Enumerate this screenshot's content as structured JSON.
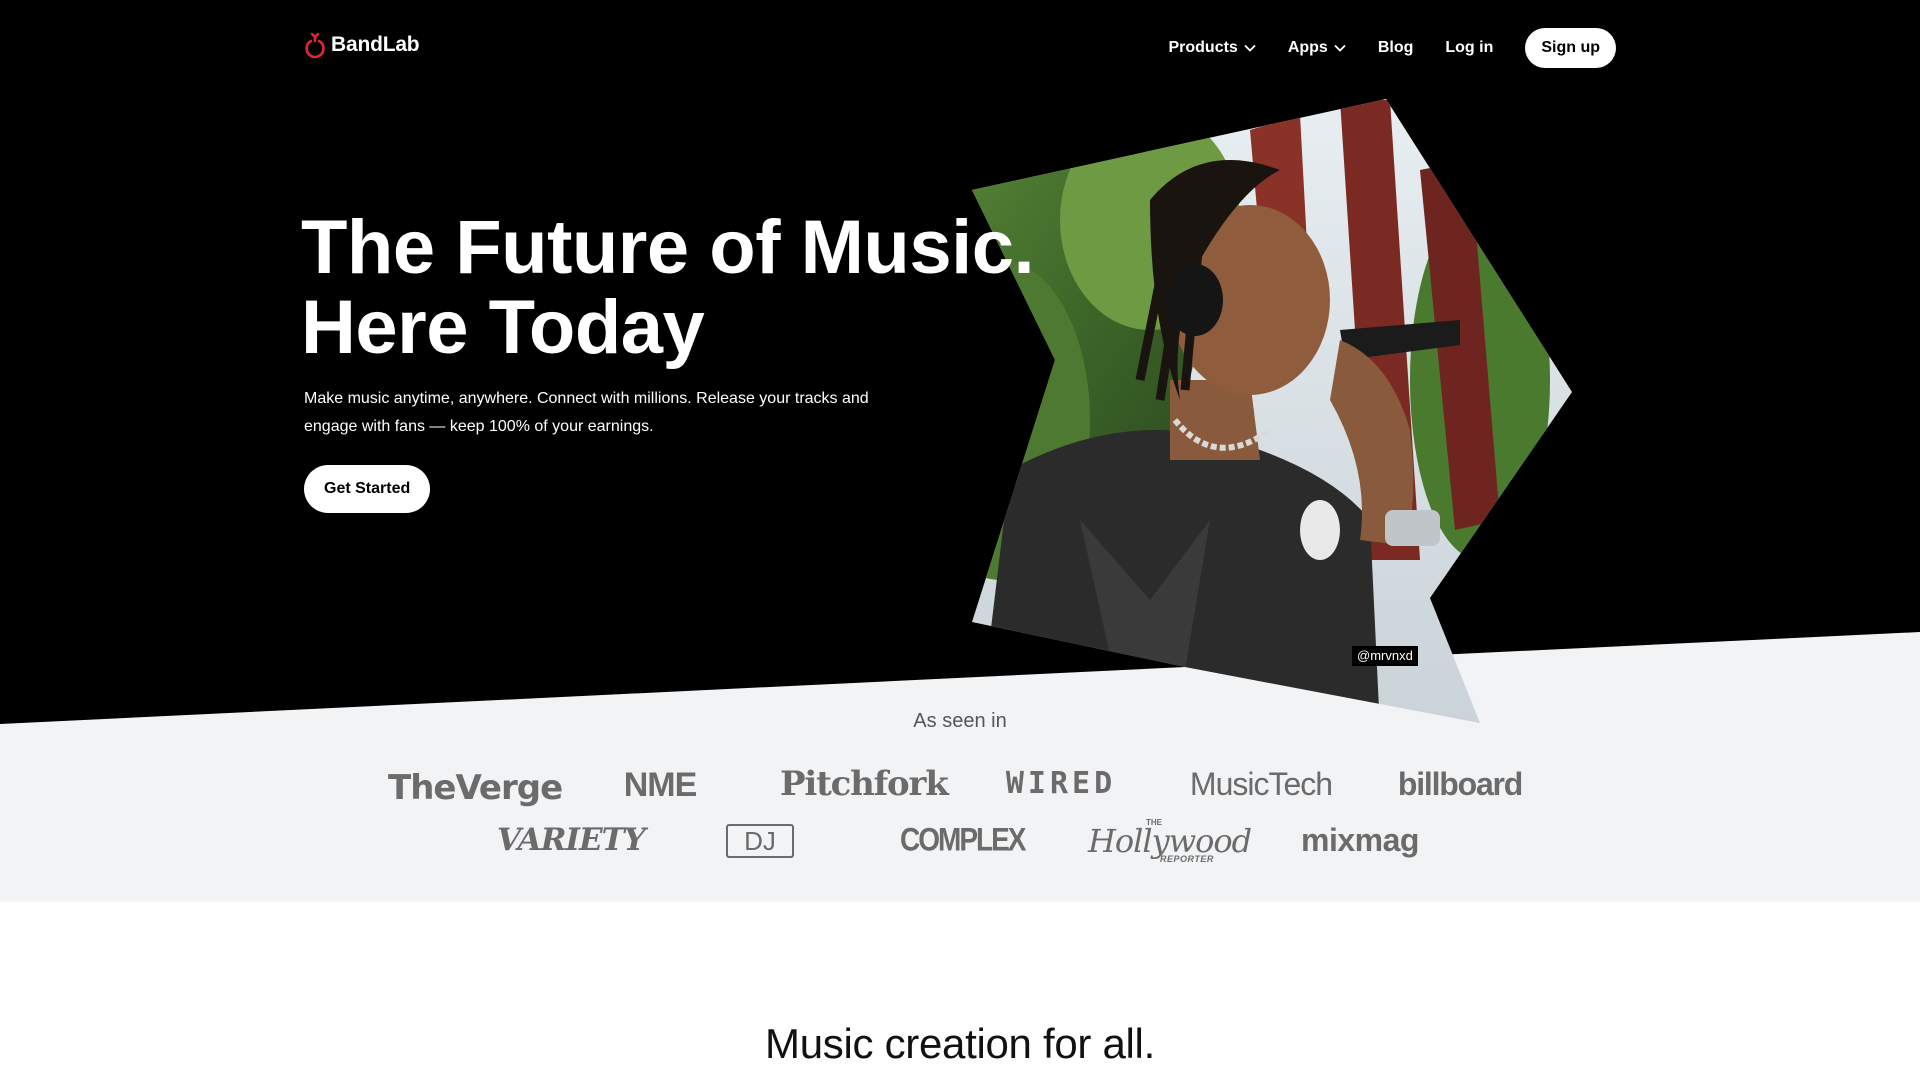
{
  "brand": {
    "name": "BandLab",
    "accent": "#e3262e"
  },
  "nav": {
    "products": "Products",
    "apps": "Apps",
    "blog": "Blog",
    "login": "Log in",
    "signup": "Sign up"
  },
  "hero": {
    "title_line1": "The Future of Music.",
    "title_line2": "Here Today",
    "subtitle": "Make music anytime, anywhere. Connect with millions. Release your tracks and engage with fans — keep 100% of your earnings.",
    "cta": "Get Started",
    "photo_credit": "@mrvnxd"
  },
  "press": {
    "label": "As seen in",
    "logos": [
      "TheVerge",
      "NME",
      "Pitchfork",
      "WIRED",
      "MusicTech",
      "billboard",
      "VARIETY",
      "DJ",
      "COMPLEX",
      "Hollywood",
      "mixmag"
    ],
    "hollywood_sub": "REPORTER",
    "hollywood_the": "THE"
  },
  "next_section": {
    "title": "Music creation for all."
  },
  "colors": {
    "hero_bg": "#000000",
    "press_bg": "#f2f3f5",
    "logo_gray": "#6b6b6b"
  }
}
